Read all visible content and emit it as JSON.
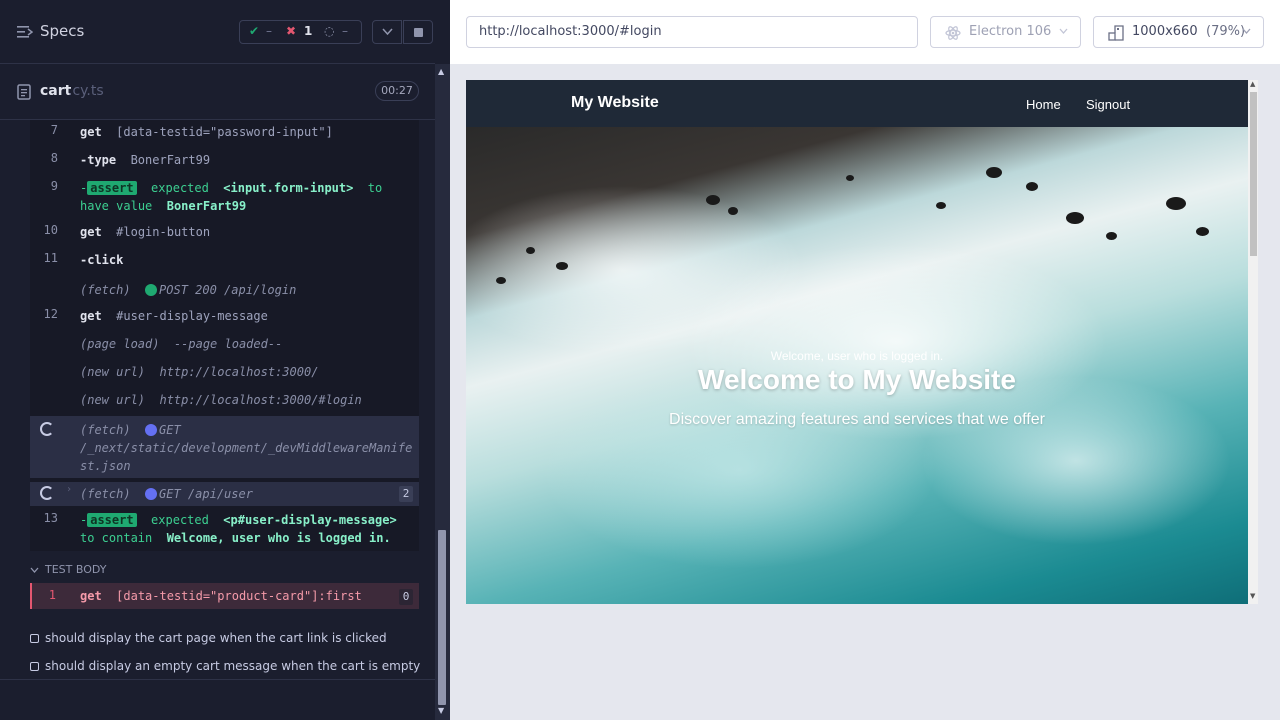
{
  "sidebar": {
    "specs_label": "Specs",
    "stats": {
      "passed": "–",
      "failed": "1",
      "pending": "–"
    },
    "file": {
      "name": "cart",
      "ext": ".cy.ts",
      "timer": "00:27"
    }
  },
  "commands": [
    {
      "num": "7",
      "name": "get",
      "arg": "[data-testid=\"password-input\"]"
    },
    {
      "num": "8",
      "name": "-type",
      "arg": "BonerFart99"
    },
    {
      "num": "9",
      "prefix": "-",
      "badge": "assert",
      "text1": "expected",
      "subject": "<input.form-input>",
      "text2": "to have",
      "text3": "value",
      "value": "BonerFart99"
    },
    {
      "num": "10",
      "name": "get",
      "arg": "#login-button"
    },
    {
      "num": "11",
      "name": "-click"
    },
    {
      "name": "(fetch)",
      "arg": "POST 200 /api/login"
    },
    {
      "num": "12",
      "name": "get",
      "arg": "#user-display-message"
    },
    {
      "name": "(page load)",
      "arg": "--page loaded--"
    },
    {
      "name": "(new url)",
      "arg": "http://localhost:3000/"
    },
    {
      "name": "(new url)",
      "arg": "http://localhost:3000/#login"
    },
    {
      "name": "(fetch)",
      "method": "GET",
      "line2": "/_next/static/development/_devMiddlewareManife",
      "line3": "st.json"
    },
    {
      "name": "(fetch)",
      "arg": "GET /api/user",
      "count": "2"
    },
    {
      "num": "13",
      "prefix": "-",
      "badge": "assert",
      "text1": "expected",
      "subject": "<p#user-display-message>",
      "text2": "to contain",
      "value": "Welcome, user who is logged in."
    }
  ],
  "test_body": {
    "label": "TEST BODY",
    "failing": {
      "num": "1",
      "name": "get",
      "arg": "[data-testid=\"product-card\"]:first",
      "count": "0"
    }
  },
  "tests": [
    "should display the cart page when the cart link is clicked",
    "should display an empty cart message when the cart is empty"
  ],
  "browser_bar": {
    "url": "http://localhost:3000/#login",
    "browser": "Electron 106",
    "viewport": "1000x660",
    "zoom": "(79%)"
  },
  "aut": {
    "brand": "My Website",
    "nav": [
      "Home",
      "Signout"
    ],
    "user_message": "Welcome, user who is logged in.",
    "title": "Welcome to My Website",
    "subtitle": "Discover amazing features and services that we offer"
  },
  "colors": {
    "pass": "#1fa971",
    "fail": "#e45770",
    "fetch_dot": "#6470f3",
    "sidebar_bg": "#1b1e2e",
    "aut_nav_bg": "#1f2937"
  }
}
